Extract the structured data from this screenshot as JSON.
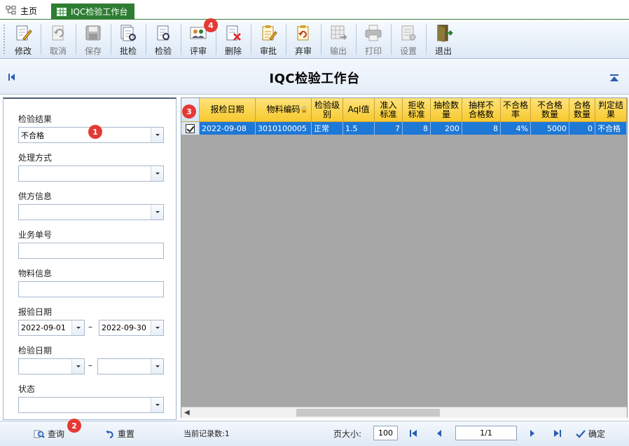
{
  "tabs": {
    "home_label": "主页",
    "active_label": "IQC检验工作台"
  },
  "toolbar": {
    "buttons": [
      {
        "label": "修改",
        "enabled": true
      },
      {
        "label": "取消",
        "enabled": false
      },
      {
        "label": "保存",
        "enabled": false
      },
      {
        "label": "批检",
        "enabled": true
      },
      {
        "label": "检验",
        "enabled": true
      },
      {
        "label": "评审",
        "enabled": true
      },
      {
        "label": "删除",
        "enabled": true
      },
      {
        "label": "审批",
        "enabled": true
      },
      {
        "label": "弃审",
        "enabled": true
      },
      {
        "label": "输出",
        "enabled": false
      },
      {
        "label": "打印",
        "enabled": false
      },
      {
        "label": "设置",
        "enabled": false
      },
      {
        "label": "退出",
        "enabled": true
      }
    ]
  },
  "page": {
    "title": "IQC检验工作台"
  },
  "badges": {
    "b1": "1",
    "b2": "2",
    "b3": "3",
    "b4": "4"
  },
  "filters": {
    "result_label": "检验结果",
    "result_value": "不合格",
    "handling_label": "处理方式",
    "handling_value": "",
    "supplier_label": "供方信息",
    "supplier_value": "",
    "order_label": "业务单号",
    "order_value": "",
    "material_label": "物料信息",
    "material_value": "",
    "report_date_label": "报验日期",
    "report_date_from": "2022-09-01",
    "report_date_to": "2022-09-30",
    "inspect_date_label": "检验日期",
    "inspect_date_from": "",
    "inspect_date_to": "",
    "status_label": "状态",
    "status_value": "",
    "range_separator": "–"
  },
  "grid": {
    "columns": [
      "报检日期",
      "物料编码",
      "检验级\n别",
      "Aql值",
      "准入\n标准",
      "拒收\n标准",
      "抽检数\n量",
      "抽样不\n合格数",
      "不合格\n率",
      "不合格\n数量",
      "合格\n数量",
      "判定结\n果"
    ],
    "rows": [
      {
        "checked": true,
        "cells": [
          "2022-09-08",
          "3010100005",
          "正常",
          "1.5",
          "7",
          "8",
          "200",
          "8",
          "4%",
          "5000",
          "0",
          "不合格"
        ]
      }
    ]
  },
  "bottom": {
    "query_label": "查询",
    "reset_label": "重置",
    "record_count_text": "当前记录数:1",
    "page_size_label": "页大小:",
    "page_size_value": "100",
    "page_indicator": "1/1",
    "confirm_label": "确定"
  }
}
